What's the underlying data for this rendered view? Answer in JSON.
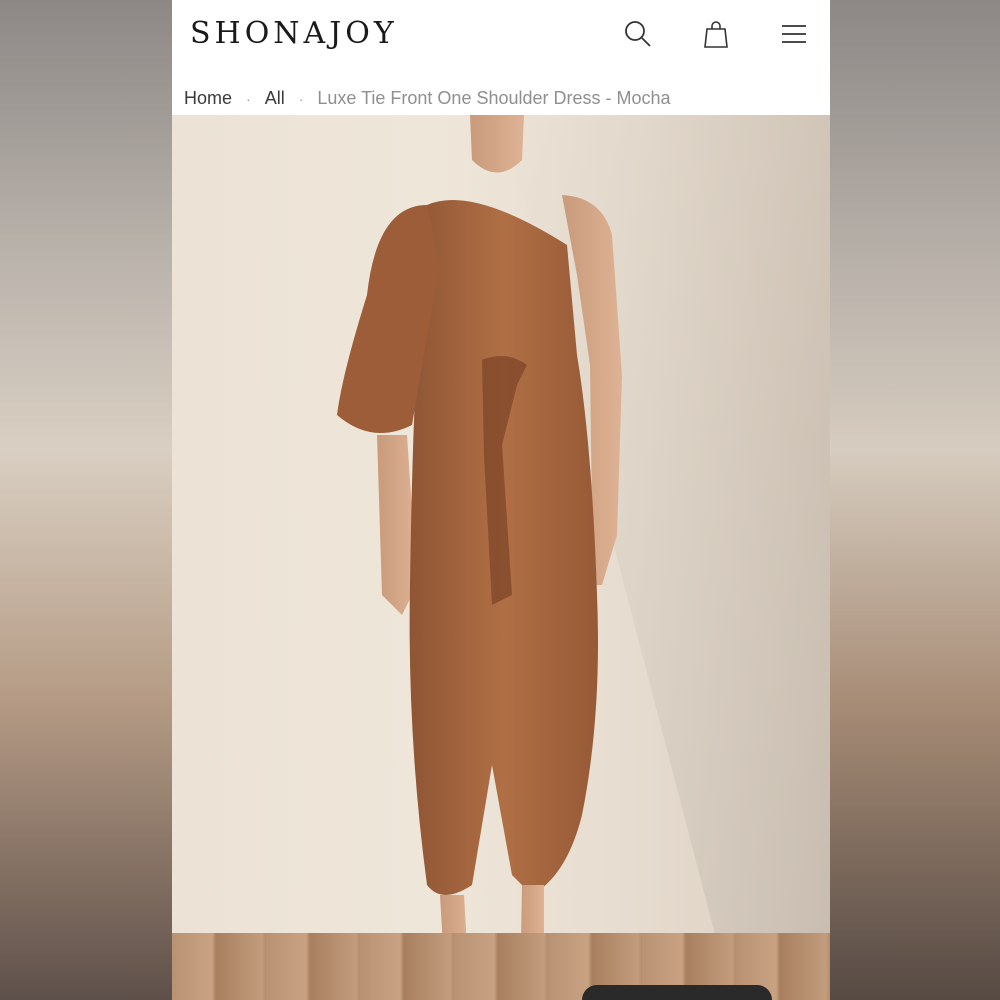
{
  "brand": {
    "logo_text": "SHONAJOY"
  },
  "header": {
    "icons": [
      "search-icon",
      "bag-icon",
      "menu-icon"
    ]
  },
  "breadcrumb": {
    "home": "Home",
    "separator": "·",
    "all": "All",
    "current": "Luxe Tie Front One Shoulder Dress - Mocha"
  },
  "colors": {
    "dress": "#a8683f",
    "background_wall": "#ece2d6",
    "text": "#1a1a1a"
  }
}
